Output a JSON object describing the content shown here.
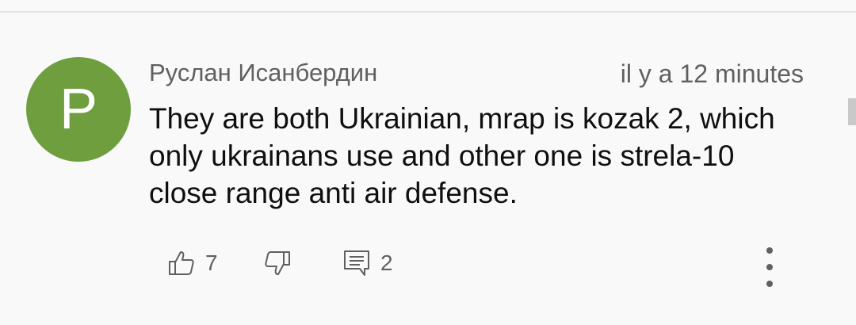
{
  "comment": {
    "avatar_letter": "P",
    "avatar_color": "#6e9e3e",
    "author": "Руслан Исанбердин",
    "timestamp": "il y a 12 minutes",
    "text_lines": [
      "They are both Ukrainian, mrap is kozak 2, which",
      "only ukrainans use and other one is strela-10",
      "close range anti air defense."
    ],
    "actions": {
      "likes": "7",
      "replies": "2",
      "like_icon": "thumbs-up-icon",
      "dislike_icon": "thumbs-down-icon",
      "reply_icon": "comment-icon",
      "more_icon": "more-vertical-icon"
    }
  }
}
